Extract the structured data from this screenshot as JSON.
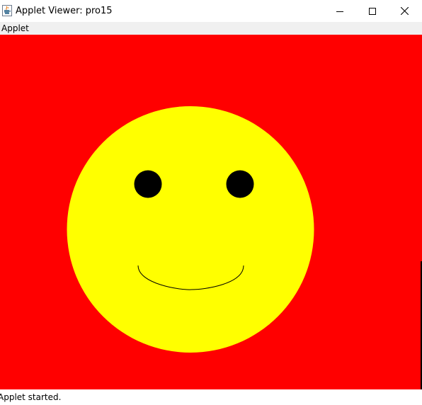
{
  "window": {
    "title": "Applet Viewer: pro15",
    "app_icon": "java-coffee-cup-icon",
    "controls": {
      "minimize_icon": "minimize-icon",
      "maximize_icon": "maximize-icon",
      "close_icon": "close-icon"
    }
  },
  "menubar": {
    "items": [
      {
        "label": "Applet"
      }
    ]
  },
  "applet": {
    "background_color": "#ff0000",
    "face_color": "#ffff00",
    "eye_color": "#000000",
    "mouth_color": "#000000"
  },
  "statusbar": {
    "text": "Applet started."
  }
}
